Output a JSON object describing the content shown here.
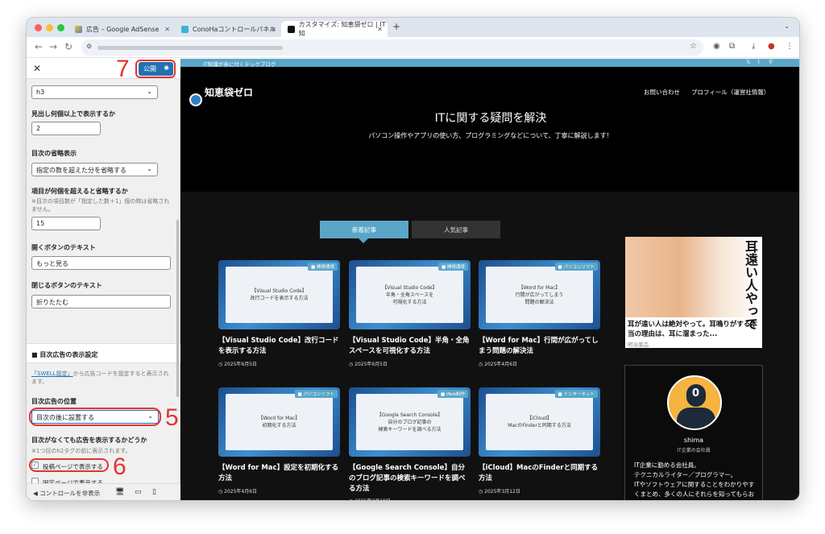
{
  "browser": {
    "tabs": [
      {
        "title": "広告 – Google AdSense"
      },
      {
        "title": "ConoHaコントロールパネル"
      },
      {
        "title": "カスタマイズ: 知恵袋ゼロ | IT知"
      }
    ],
    "new_tab": "+",
    "menu": "⌄"
  },
  "panel": {
    "publish_label": "公開",
    "step7": "7",
    "step5": "5",
    "step6": "6",
    "heading_level": "h3",
    "min_headings_label": "見出し何個以上で表示するか",
    "min_headings_value": "2",
    "omit_label": "目次の省略表示",
    "omit_value": "指定の数を超えた分を省略する",
    "omit_count_label": "項目が何個を超えると省略するか",
    "omit_count_note": "※目次の項目数が「指定した数＋1」個の時は省略されません。",
    "omit_count_value": "15",
    "open_btn_label": "開くボタンのテキスト",
    "open_btn_value": "もっと見る",
    "close_btn_label": "閉じるボタンのテキスト",
    "close_btn_value": "折りたたむ",
    "ad_section_title": "■ 目次広告の表示設定",
    "ad_note_link": "「SWELL設定」",
    "ad_note_rest": "から広告コードを設定すると表示されます。",
    "ad_pos_label": "目次広告の位置",
    "ad_pos_value": "目次の後に設置する",
    "no_toc_label": "目次がなくても広告を表示するかどうか",
    "no_toc_note": "※1つ目のh2タグの前に表示されます。",
    "chk_post": "投稿ページで表示する",
    "chk_fixed": "固定ページで表示する",
    "hide_controls": "コントロールを非表示"
  },
  "site": {
    "tagline": "IT知識が身に付くテックブログ",
    "name": "知恵袋ゼロ",
    "nav": [
      "お問い合わせ",
      "プロフィール（運営社情報）"
    ],
    "hero_title": "ITに関する疑問を解決",
    "hero_sub": "パソコン操作やアプリの使い方、プログラミングなどについて、丁寧に解説します！",
    "tab_new": "新着記事",
    "tab_popular": "人気記事",
    "posts": [
      {
        "cat": "開発環境",
        "thumb": "【Visual Studio Code】\n改行コードを表示する方法",
        "title": "【Visual Studio Code】改行コードを表示する方法",
        "date": "2025年6月5日"
      },
      {
        "cat": "開発環境",
        "thumb": "【Visual Studio Code】\n半角・全角スペースを\n可視化する方法",
        "title": "【Visual Studio Code】半角・全角スペースを可視化する方法",
        "date": "2025年6月5日"
      },
      {
        "cat": "パソコンソフト",
        "thumb": "【Word for Mac】\n行間が広がってしまう\n問題の解決法",
        "title": "【Word for Mac】行間が広がってしまう問題の解決法",
        "date": "2025年4月6日"
      },
      {
        "cat": "パソコンソフト",
        "thumb": "【Word for Mac】\n初期化する方法",
        "title": "【Word for Mac】設定を初期化する方法",
        "date": "2025年4月6日"
      },
      {
        "cat": "Web制作",
        "thumb": "【Google Search Console】\n自分のブログ記事の\n検索キーワードを調べる方法",
        "title": "【Google Search Console】自分のブログ記事の検索キーワードを調べる方法",
        "date": "2025年3月18日"
      },
      {
        "cat": "インターネット",
        "thumb": "【iCloud】\nMacのFinderと同期する方法",
        "title": "【iCloud】MacのFinderと同期する方法",
        "date": "2025年3月12日"
      }
    ],
    "ad_vertical": "耳遠い人やって",
    "ad_text": "耳が遠い人は絶対やって。耳鳴りがする本当の理由は、耳に溜まった...",
    "ad_source": "明治薬品",
    "profile_name": "shima",
    "profile_role": "IT企業の会社員",
    "profile_bio": "IT企業に勤める会社員。\nテクニカルライター／プログラマー。\nITやソフトウェアに関することをわかりやすくまとめ、多くの人にそれらを知ってもらおうと活動しています。\nご質問やご要望、お仕事依頼がございました"
  }
}
